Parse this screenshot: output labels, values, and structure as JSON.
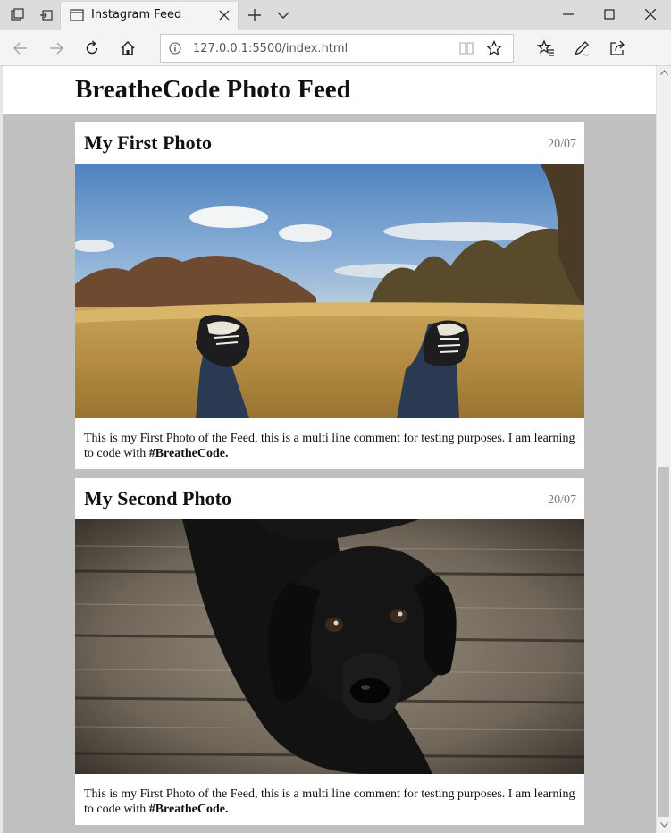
{
  "browser": {
    "tab": {
      "title": "Instagram Feed"
    },
    "address": {
      "url": "127.0.0.1:5500/index.html"
    }
  },
  "page": {
    "title": "BreatheCode Photo Feed",
    "posts": [
      {
        "title": "My First Photo",
        "date": "20/07",
        "caption_text": "This is my First Photo of the Feed, this is a multi line comment for testing purposes. I am learning to code with ",
        "caption_tag": "#BreatheCode.",
        "photo": "sneakers-in-field-photo"
      },
      {
        "title": "My Second Photo",
        "date": "20/07",
        "caption_text": "This is my First Photo of the Feed, this is a multi line comment for testing purposes. I am learning to code with ",
        "caption_tag": "#BreatheCode.",
        "photo": "black-puppy-photo"
      }
    ]
  },
  "colors": {
    "page_background": "#c0c0c0",
    "card_background": "#ffffff",
    "chrome_background": "#f4f4f4",
    "tab_strip": "#dcdcdc",
    "date_text": "#777777"
  },
  "icons": [
    "tab-preview-icon",
    "set-aside-tabs-icon",
    "page-icon",
    "close-icon",
    "plus-icon",
    "chevron-down-icon",
    "minimize-icon",
    "maximize-icon",
    "back-arrow-icon",
    "forward-arrow-icon",
    "refresh-icon",
    "home-icon",
    "info-icon",
    "reading-view-icon",
    "star-icon",
    "favorites-icon",
    "pen-icon",
    "share-icon"
  ]
}
